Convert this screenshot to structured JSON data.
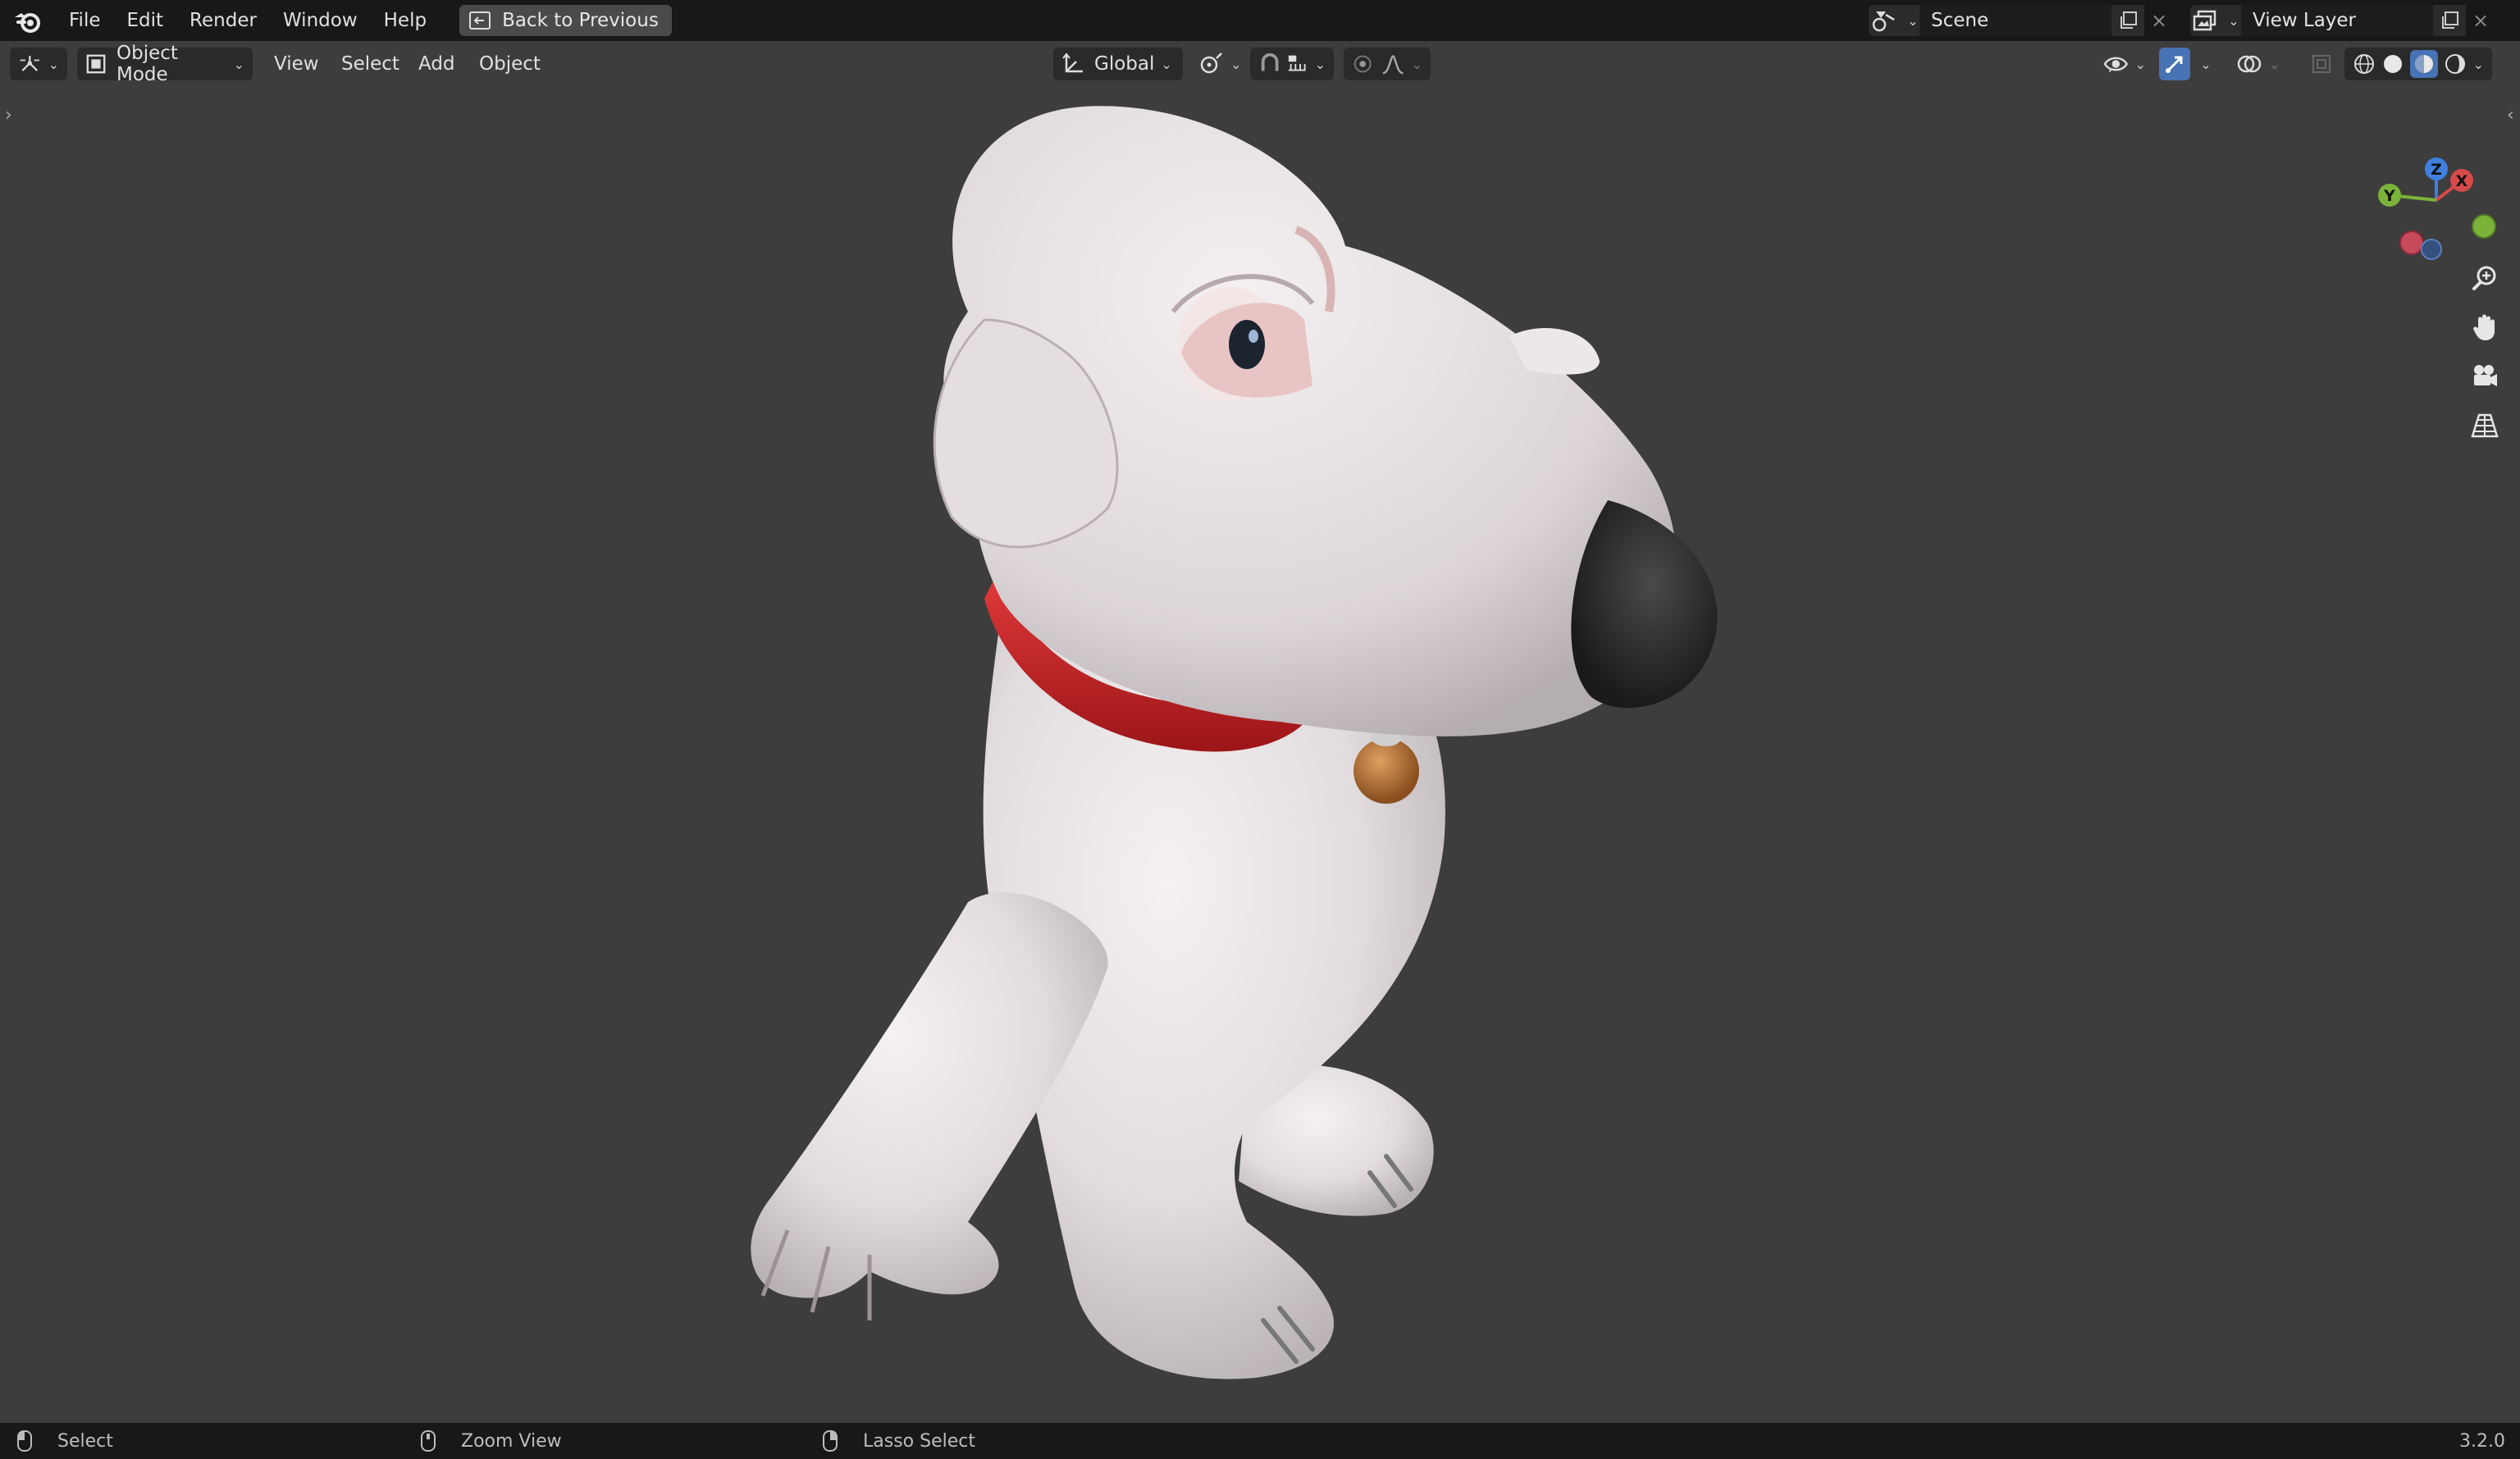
{
  "topbar": {
    "menus": [
      "File",
      "Edit",
      "Render",
      "Window",
      "Help"
    ],
    "back_button": "Back to Previous",
    "scene_name": "Scene",
    "view_layer_name": "View Layer"
  },
  "header": {
    "mode": "Object Mode",
    "menus": [
      "View",
      "Select",
      "Add",
      "Object"
    ],
    "transform_orientation": "Global"
  },
  "statusbar": {
    "left_action": "Select",
    "middle_action": "Zoom View",
    "right_action": "Lasso Select",
    "version": "3.2.0"
  },
  "gizmo": {
    "axis_z": "Z",
    "axis_x": "X",
    "axis_y": "Y"
  },
  "colors": {
    "background": "#3d3d3d",
    "topbar": "#181818",
    "accent_blue": "#4772b3",
    "collar_red": "#c4242a",
    "axis_x": "#d64a4a",
    "axis_y": "#7bb33a",
    "axis_z": "#3f7fe0"
  },
  "icons": [
    "blender-logo-icon",
    "back-icon",
    "scene-icon",
    "view-layer-icon",
    "editor-type-icon",
    "object-mode-icon",
    "orientation-icon",
    "pivot-icon",
    "snap-icon",
    "proportional-icon",
    "visibility-icon",
    "gizmo-icon",
    "overlay-icon",
    "xray-icon",
    "wireframe-shading-icon",
    "solid-shading-icon",
    "material-shading-icon",
    "rendered-shading-icon",
    "zoom-icon",
    "pan-hand-icon",
    "camera-icon",
    "perspective-grid-icon",
    "mouse-icon"
  ]
}
